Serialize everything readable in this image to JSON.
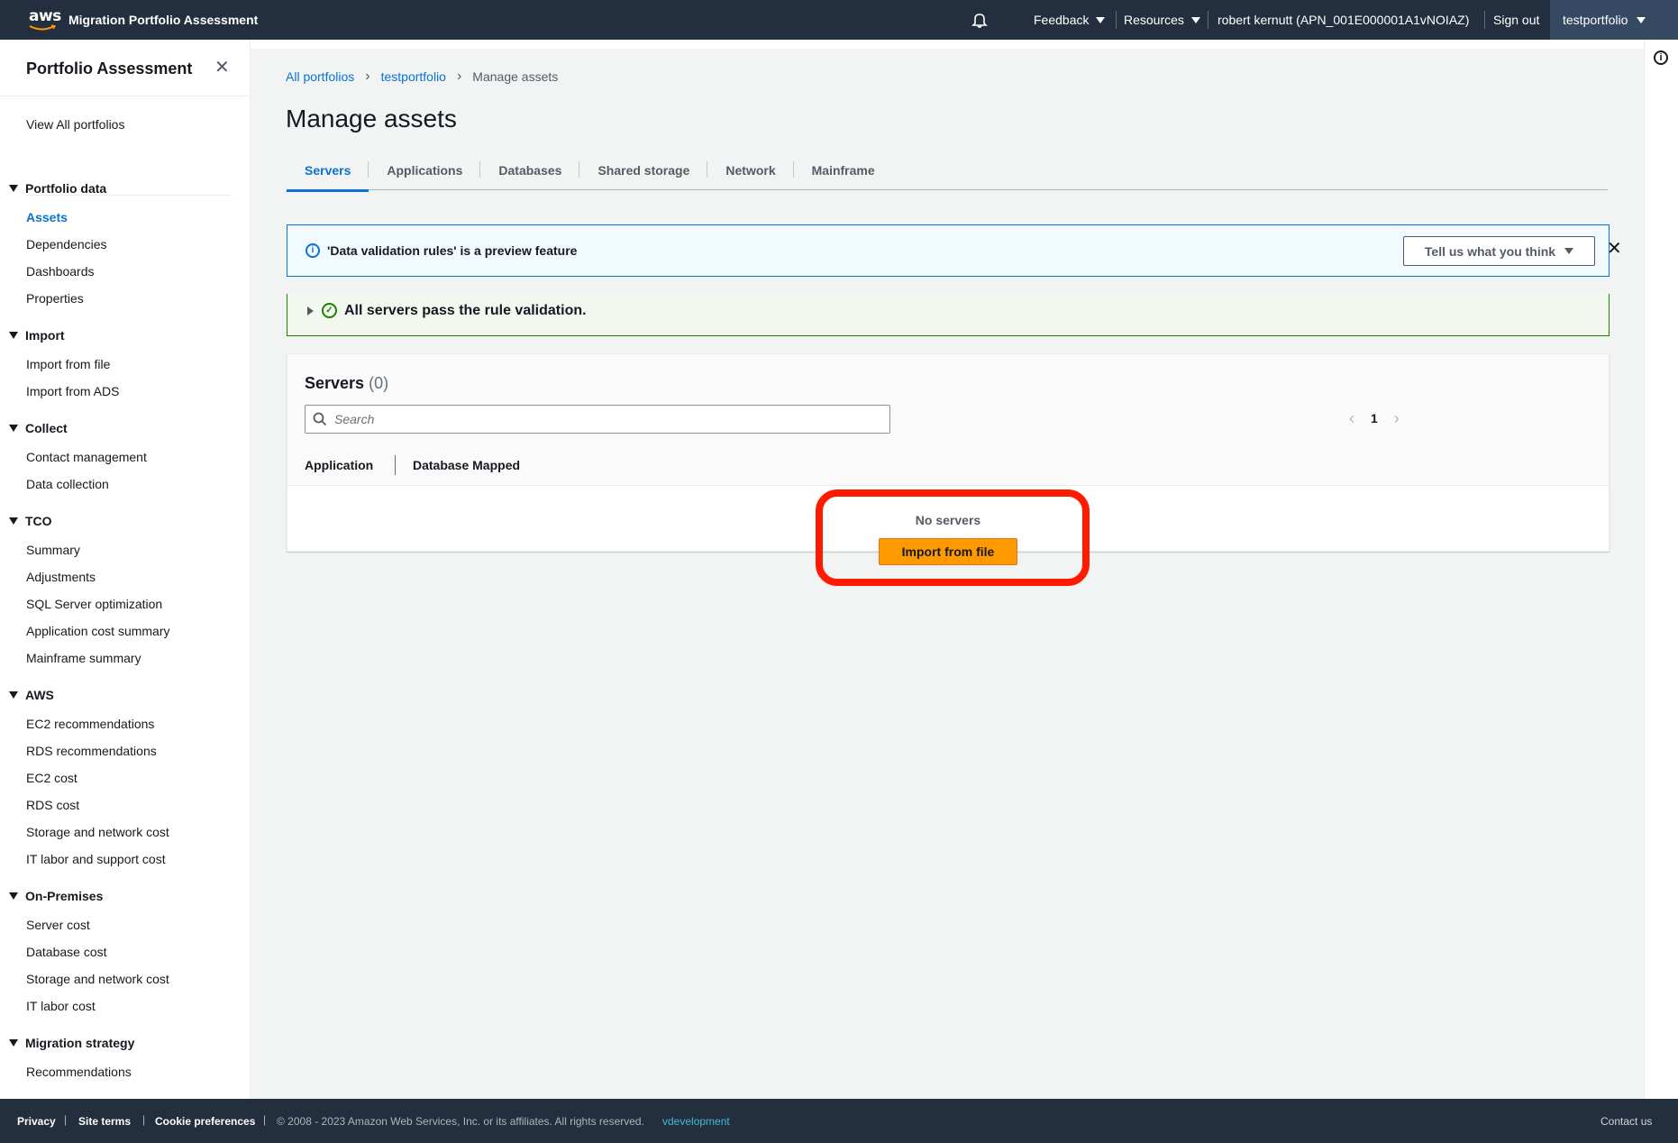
{
  "topnav": {
    "brand": "aws",
    "app_title": "Migration Portfolio Assessment",
    "feedback": "Feedback",
    "resources": "Resources",
    "user": "robert kernutt (APN_001E000001A1vNOIAZ)",
    "sign_out": "Sign out",
    "portfolio": "testportfolio",
    "icons": [
      "notification-bell-icon",
      "caret-down-icon"
    ]
  },
  "sidebar": {
    "header": "Portfolio Assessment",
    "view_all": "View All portfolios",
    "sections": [
      {
        "title": "Portfolio data",
        "items": [
          "Assets",
          "Dependencies",
          "Dashboards",
          "Properties"
        ]
      },
      {
        "title": "Import",
        "items": [
          "Import from file",
          "Import from ADS"
        ]
      },
      {
        "title": "Collect",
        "items": [
          "Contact management",
          "Data collection"
        ]
      },
      {
        "title": "TCO",
        "items": [
          "Summary",
          "Adjustments",
          "SQL Server optimization",
          "Application cost summary",
          "Mainframe summary"
        ]
      },
      {
        "title": "AWS",
        "items": [
          "EC2 recommendations",
          "RDS recommendations",
          "EC2 cost",
          "RDS cost",
          "Storage and network cost",
          "IT labor and support cost"
        ]
      },
      {
        "title": "On-Premises",
        "items": [
          "Server cost",
          "Database cost",
          "Storage and network cost",
          "IT labor cost"
        ]
      },
      {
        "title": "Migration strategy",
        "items": [
          "Recommendations"
        ]
      }
    ],
    "active_item": "Assets"
  },
  "breadcrumb": {
    "items": [
      "All portfolios",
      "testportfolio"
    ],
    "current": "Manage assets"
  },
  "page_title": "Manage assets",
  "tabs": [
    "Servers",
    "Applications",
    "Databases",
    "Shared storage",
    "Network",
    "Mainframe"
  ],
  "active_tab": "Servers",
  "flash": {
    "message": "'Data validation rules' is a preview feature",
    "feedback_button": "Tell us what you think"
  },
  "validation": {
    "message": "All servers pass the rule validation."
  },
  "servers_table": {
    "title": "Servers",
    "count": "(0)",
    "search_placeholder": "Search",
    "page": "1",
    "columns": [
      "Application",
      "Database Mapped"
    ],
    "empty_text": "No servers",
    "empty_action": "Import from file"
  },
  "footer": {
    "privacy": "Privacy",
    "site_terms": "Site terms",
    "cookie": "Cookie preferences",
    "copyright": "© 2008 - 2023 Amazon Web Services, Inc. or its affiliates. All rights reserved.",
    "env": "vdevelopment",
    "contact": "Contact us"
  },
  "colors": {
    "nav_bg": "#232f3e",
    "link_blue": "#0972d3",
    "primary_orange": "#ff9900",
    "success_green": "#1d8102",
    "highlight_red": "#ff1a00"
  }
}
